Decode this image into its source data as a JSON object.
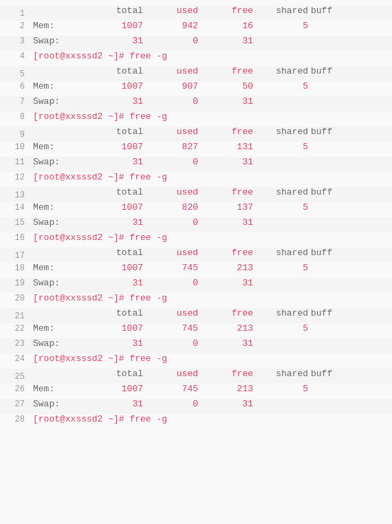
{
  "terminal": {
    "lines": [
      {
        "num": 1,
        "type": "header",
        "cols": [
          "",
          "total",
          "used",
          "free",
          "shared",
          "buff"
        ]
      },
      {
        "num": 2,
        "type": "memswap",
        "label": "Mem:",
        "total": "1007",
        "used": "942",
        "free": "16",
        "shared": "5",
        "buff": ""
      },
      {
        "num": 3,
        "type": "memswap",
        "label": "Swap:",
        "total": "31",
        "used": "0",
        "free": "31",
        "shared": "",
        "buff": ""
      },
      {
        "num": 4,
        "type": "cmd",
        "text": "[root@xxsssd2 ~]# free -g"
      },
      {
        "num": 5,
        "type": "header",
        "cols": [
          "",
          "total",
          "used",
          "free",
          "shared",
          "buff"
        ]
      },
      {
        "num": 6,
        "type": "memswap",
        "label": "Mem:",
        "total": "1007",
        "used": "907",
        "free": "50",
        "shared": "5",
        "buff": ""
      },
      {
        "num": 7,
        "type": "memswap",
        "label": "Swap:",
        "total": "31",
        "used": "0",
        "free": "31",
        "shared": "",
        "buff": ""
      },
      {
        "num": 8,
        "type": "cmd",
        "text": "[root@xxsssd2 ~]# free -g"
      },
      {
        "num": 9,
        "type": "header",
        "cols": [
          "",
          "total",
          "used",
          "free",
          "shared",
          "buff"
        ]
      },
      {
        "num": 10,
        "type": "memswap",
        "label": "Mem:",
        "total": "1007",
        "used": "827",
        "free": "131",
        "shared": "5",
        "buff": ""
      },
      {
        "num": 11,
        "type": "memswap",
        "label": "Swap:",
        "total": "31",
        "used": "0",
        "free": "31",
        "shared": "",
        "buff": ""
      },
      {
        "num": 12,
        "type": "cmd",
        "text": "[root@xxsssd2 ~]# free -g"
      },
      {
        "num": 13,
        "type": "header",
        "cols": [
          "",
          "total",
          "used",
          "free",
          "shared",
          "buff"
        ]
      },
      {
        "num": 14,
        "type": "memswap",
        "label": "Mem:",
        "total": "1007",
        "used": "820",
        "free": "137",
        "shared": "5",
        "buff": ""
      },
      {
        "num": 15,
        "type": "memswap",
        "label": "Swap:",
        "total": "31",
        "used": "0",
        "free": "31",
        "shared": "",
        "buff": ""
      },
      {
        "num": 16,
        "type": "cmd",
        "text": "[root@xxsssd2 ~]# free -g"
      },
      {
        "num": 17,
        "type": "header",
        "cols": [
          "",
          "total",
          "used",
          "free",
          "shared",
          "buff"
        ]
      },
      {
        "num": 18,
        "type": "memswap",
        "label": "Mem:",
        "total": "1007",
        "used": "745",
        "free": "213",
        "shared": "5",
        "buff": ""
      },
      {
        "num": 19,
        "type": "memswap",
        "label": "Swap:",
        "total": "31",
        "used": "0",
        "free": "31",
        "shared": "",
        "buff": ""
      },
      {
        "num": 20,
        "type": "cmd",
        "text": "[root@xxsssd2 ~]# free -g"
      },
      {
        "num": 21,
        "type": "header",
        "cols": [
          "",
          "total",
          "used",
          "free",
          "shared",
          "buff"
        ]
      },
      {
        "num": 22,
        "type": "memswap",
        "label": "Mem:",
        "total": "1007",
        "used": "745",
        "free": "213",
        "shared": "5",
        "buff": ""
      },
      {
        "num": 23,
        "type": "memswap",
        "label": "Swap:",
        "total": "31",
        "used": "0",
        "free": "31",
        "shared": "",
        "buff": ""
      },
      {
        "num": 24,
        "type": "cmd",
        "text": "[root@xxsssd2 ~]# free -g"
      },
      {
        "num": 25,
        "type": "header",
        "cols": [
          "",
          "total",
          "used",
          "free",
          "shared",
          "buff"
        ]
      },
      {
        "num": 26,
        "type": "memswap",
        "label": "Mem:",
        "total": "1007",
        "used": "745",
        "free": "213",
        "shared": "5",
        "buff": ""
      },
      {
        "num": 27,
        "type": "memswap",
        "label": "Swap:",
        "total": "31",
        "used": "0",
        "free": "31",
        "shared": "",
        "buff": ""
      },
      {
        "num": 28,
        "type": "cmd",
        "text": "[root@xxsssd2 ~]# free -g"
      }
    ]
  }
}
